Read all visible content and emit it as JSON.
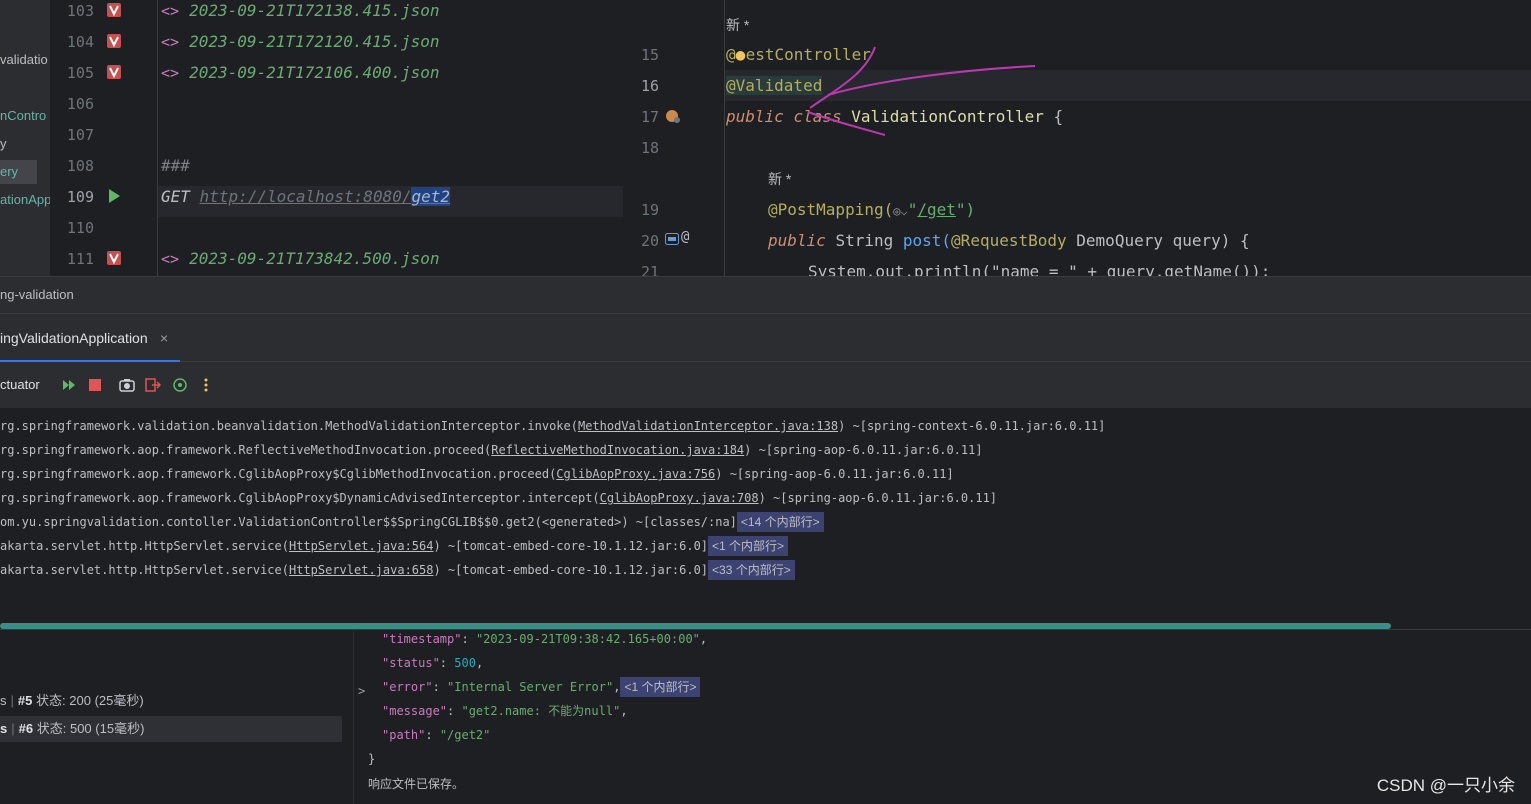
{
  "project": {
    "items": [
      {
        "label": "validatio",
        "color": "#bcbec4"
      },
      {
        "label": "nContro",
        "color": "#5fb8a8"
      },
      {
        "label": "y",
        "color": "#bcbec4"
      },
      {
        "label": "ery",
        "color": "#5fb8a8"
      },
      {
        "label": "ationApp",
        "color": "#5fb8a8"
      }
    ]
  },
  "http_editor": {
    "line_numbers": [
      "103",
      "104",
      "105",
      "106",
      "107",
      "108",
      "109",
      "110",
      "111"
    ],
    "lines": [
      {
        "type": "file",
        "text": "2023-09-21T172138.415.json"
      },
      {
        "type": "file",
        "text": "2023-09-21T172120.415.json"
      },
      {
        "type": "file",
        "text": "2023-09-21T172106.400.json"
      },
      {
        "type": "blank",
        "text": ""
      },
      {
        "type": "blank",
        "text": ""
      },
      {
        "type": "sep",
        "text": "###"
      },
      {
        "type": "request",
        "method": "GET",
        "url_prefix": "http://localhost:8080/",
        "url_path": "get2"
      },
      {
        "type": "blank",
        "text": ""
      },
      {
        "type": "file",
        "text": "2023-09-21T173842.500.json"
      }
    ]
  },
  "java_editor": {
    "line_numbers": [
      "15",
      "16",
      "17",
      "18",
      "19",
      "20",
      "21"
    ],
    "hint_new": "新 *",
    "hint_new2": "新 *",
    "rest_annotation_prefix": "@",
    "rest_annotation_rest": "estController",
    "validated": "@Validated",
    "class_kw_public": "public",
    "class_kw_class": "class",
    "class_name": "ValidationController",
    "class_brace": "{",
    "mapping_annotation": "@PostMapping(",
    "mapping_icons": "◎⌵",
    "mapping_str_open": "\"",
    "mapping_path": "/get",
    "mapping_str_close": "\")",
    "method_public": "public",
    "method_type": "String",
    "method_name": "post(",
    "param_annotation": "@RequestBody",
    "param_type": "DemoQuery",
    "param_name": "query) {",
    "partial_line": "System.out.println(\"name = \" + query.getName());"
  },
  "breadcrumb": {
    "text": "ng-validation"
  },
  "run_tab": {
    "label": "ingValidationApplication",
    "close": "×"
  },
  "toolbar": {
    "label": "ctuator"
  },
  "console": {
    "lines": [
      {
        "pre": "rg.springframework.validation.beanvalidation.MethodValidationInterceptor.invoke(",
        "link": "MethodValidationInterceptor.java:138",
        "post": ") ~[spring-context-6.0.11.jar:6.0.11]",
        "fold": ""
      },
      {
        "pre": "rg.springframework.aop.framework.ReflectiveMethodInvocation.proceed(",
        "link": "ReflectiveMethodInvocation.java:184",
        "post": ") ~[spring-aop-6.0.11.jar:6.0.11]",
        "fold": ""
      },
      {
        "pre": "rg.springframework.aop.framework.CglibAopProxy$CglibMethodInvocation.proceed(",
        "link": "CglibAopProxy.java:756",
        "post": ") ~[spring-aop-6.0.11.jar:6.0.11]",
        "fold": ""
      },
      {
        "pre": "rg.springframework.aop.framework.CglibAopProxy$DynamicAdvisedInterceptor.intercept(",
        "link": "CglibAopProxy.java:708",
        "post": ") ~[spring-aop-6.0.11.jar:6.0.11]",
        "fold": ""
      },
      {
        "pre": "om.yu.springvalidation.contoller.ValidationController$$SpringCGLIB$$0.get2(<generated>) ~[classes/:na]",
        "link": "",
        "post": "",
        "fold": "<14 个内部行>"
      },
      {
        "pre": "akarta.servlet.http.HttpServlet.service(",
        "link": "HttpServlet.java:564",
        "post": ") ~[tomcat-embed-core-10.1.12.jar:6.0]",
        "fold": "<1 个内部行>"
      },
      {
        "pre": "akarta.servlet.http.HttpServlet.service(",
        "link": "HttpServlet.java:658",
        "post": ") ~[tomcat-embed-core-10.1.12.jar:6.0]",
        "fold": "<33 个内部行>"
      }
    ]
  },
  "requests": [
    {
      "prefix": "s",
      "id": "#5",
      "status_label": "状态:",
      "status": "200",
      "time": "(25毫秒)"
    },
    {
      "prefix": "s",
      "id": "#6",
      "status_label": "状态:",
      "status": "500",
      "time": "(15毫秒)"
    }
  ],
  "response": {
    "timestamp_key": "\"timestamp\"",
    "timestamp_val": "\"2023-09-21T09:38:42.165+00:00\"",
    "status_key": "\"status\"",
    "status_val": "500",
    "error_key": "\"error\"",
    "error_val": "\"Internal Server Error\"",
    "error_fold": "<1 个内部行>",
    "message_key": "\"message\"",
    "message_val": "\"get2.name: 不能为null\"",
    "path_key": "\"path\"",
    "path_val": "\"/get2\"",
    "close_brace": "}",
    "saved": "响应文件已保存。"
  },
  "watermark": "CSDN @一只小余",
  "colors": {
    "accent": "#3574f0",
    "scroll": "#3b8e84",
    "pen": "#b93ab0"
  }
}
